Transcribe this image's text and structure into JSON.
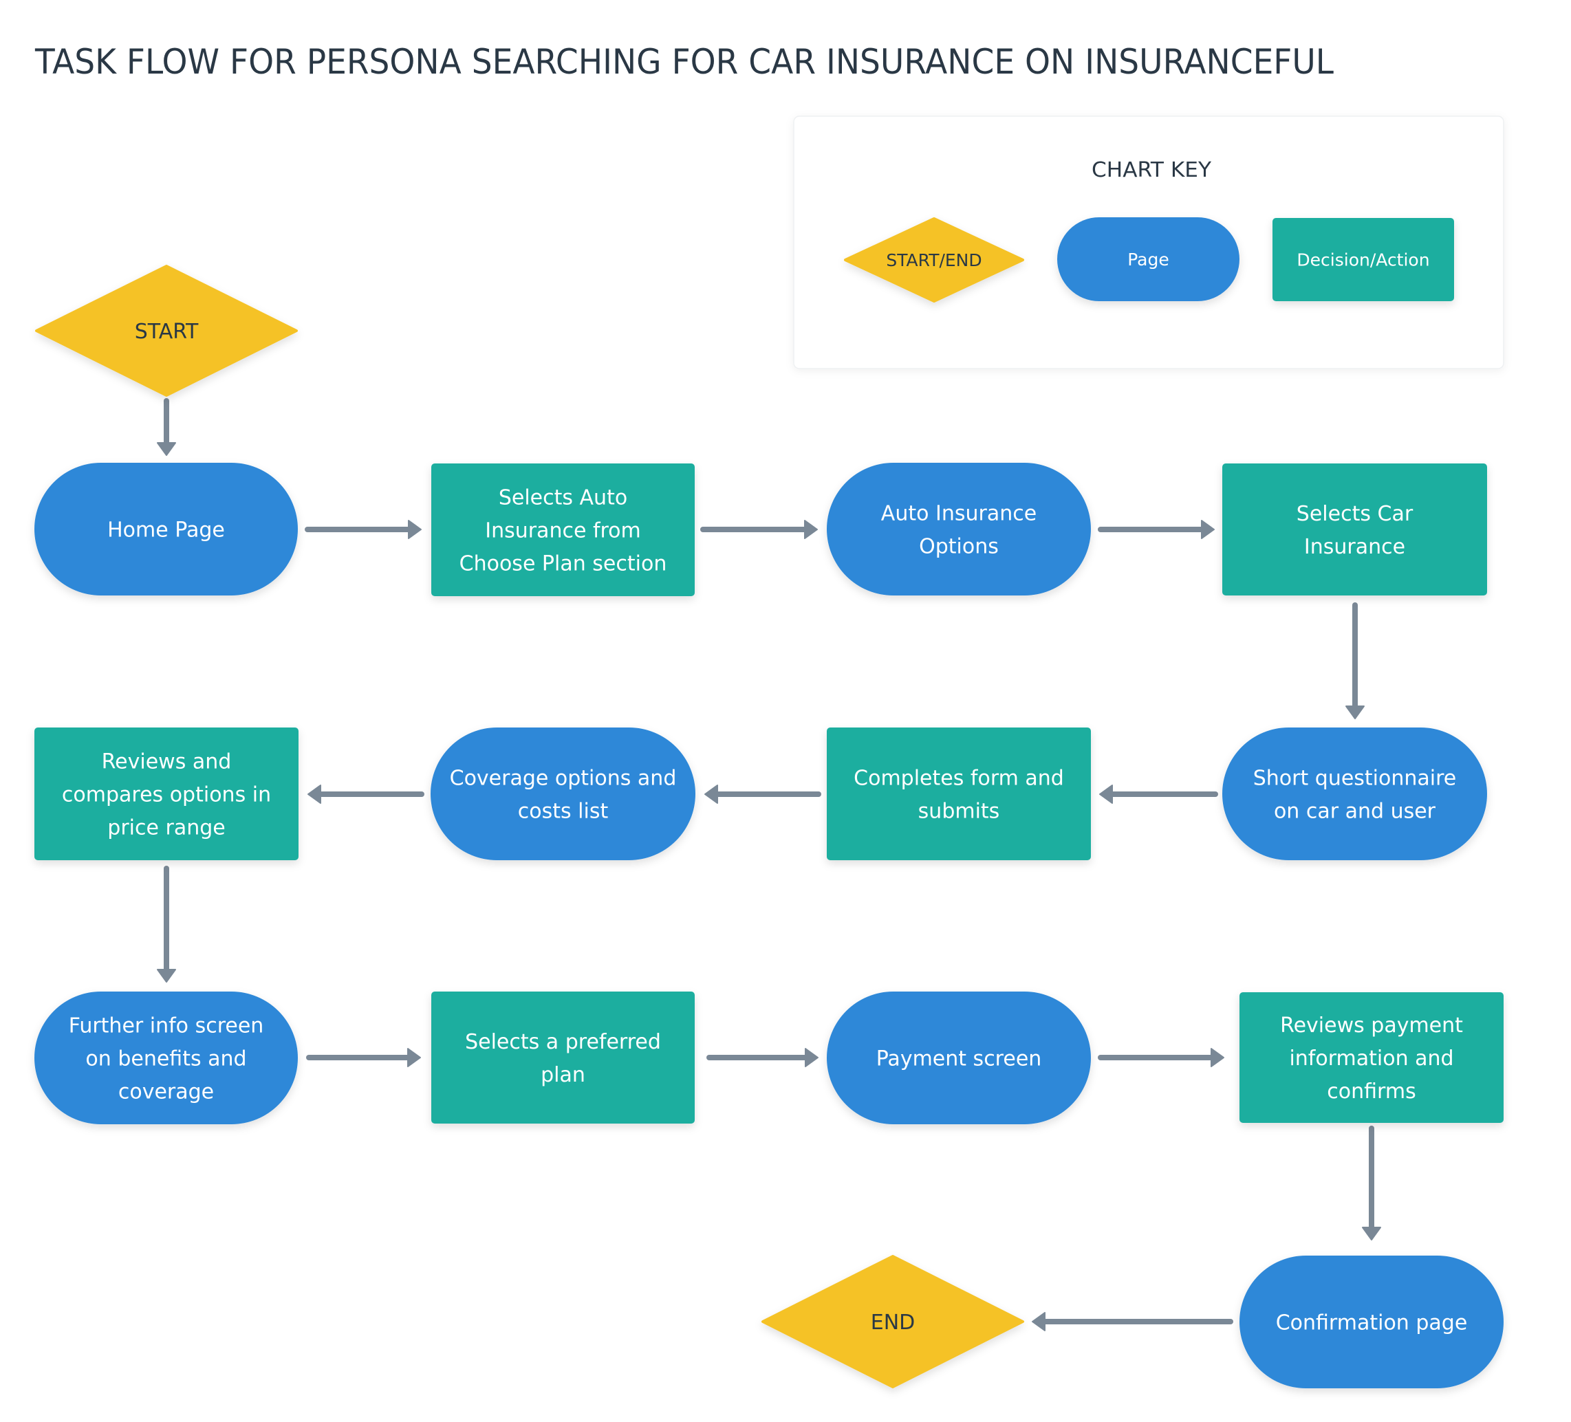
{
  "title": "TASK FLOW FOR PERSONA SEARCHING FOR CAR INSURANCE ON INSURANCEFUL",
  "colors": {
    "start_end": "#f5c226",
    "page": "#2e88d8",
    "decision_action": "#1bae9f",
    "arrow": "#7a8896",
    "dark_text": "#2a3845",
    "light_text": "#ffffff",
    "key_border": "#eef0f2"
  },
  "chart_key": {
    "title": "CHART KEY",
    "items": [
      {
        "type": "start_end",
        "label": "START/END"
      },
      {
        "type": "page",
        "label": "Page"
      },
      {
        "type": "decision_action",
        "label": "Decision/Action"
      }
    ]
  },
  "nodes": [
    {
      "id": "start",
      "type": "start_end",
      "lines": [
        "START"
      ]
    },
    {
      "id": "home-page",
      "type": "page",
      "lines": [
        "Home Page"
      ]
    },
    {
      "id": "selects-auto-insurance",
      "type": "decision_action",
      "lines": [
        "Selects Auto",
        "Insurance from",
        "Choose Plan section"
      ]
    },
    {
      "id": "auto-insurance-options",
      "type": "page",
      "lines": [
        "Auto Insurance",
        "Options"
      ]
    },
    {
      "id": "selects-car-insurance",
      "type": "decision_action",
      "lines": [
        "Selects Car",
        "Insurance"
      ]
    },
    {
      "id": "short-questionnaire",
      "type": "page",
      "lines": [
        "Short questionnaire",
        "on car and user"
      ]
    },
    {
      "id": "completes-form",
      "type": "decision_action",
      "lines": [
        "Completes form and",
        "submits"
      ]
    },
    {
      "id": "coverage-options-list",
      "type": "page",
      "lines": [
        "Coverage options and",
        "costs list"
      ]
    },
    {
      "id": "reviews-compares-options",
      "type": "decision_action",
      "lines": [
        "Reviews and",
        "compares options in",
        "price range"
      ]
    },
    {
      "id": "further-info-screen",
      "type": "page",
      "lines": [
        "Further info screen",
        "on benefits and",
        "coverage"
      ]
    },
    {
      "id": "selects-preferred-plan",
      "type": "decision_action",
      "lines": [
        "Selects a preferred",
        "plan"
      ]
    },
    {
      "id": "payment-screen",
      "type": "page",
      "lines": [
        "Payment screen"
      ]
    },
    {
      "id": "reviews-payment-info",
      "type": "decision_action",
      "lines": [
        "Reviews payment",
        "information and",
        "confirms"
      ]
    },
    {
      "id": "confirmation-page",
      "type": "page",
      "lines": [
        "Confirmation page"
      ]
    },
    {
      "id": "end",
      "type": "start_end",
      "lines": [
        "END"
      ]
    }
  ],
  "edges": [
    {
      "from": "start",
      "to": "home-page"
    },
    {
      "from": "home-page",
      "to": "selects-auto-insurance"
    },
    {
      "from": "selects-auto-insurance",
      "to": "auto-insurance-options"
    },
    {
      "from": "auto-insurance-options",
      "to": "selects-car-insurance"
    },
    {
      "from": "selects-car-insurance",
      "to": "short-questionnaire"
    },
    {
      "from": "short-questionnaire",
      "to": "completes-form"
    },
    {
      "from": "completes-form",
      "to": "coverage-options-list"
    },
    {
      "from": "coverage-options-list",
      "to": "reviews-compares-options"
    },
    {
      "from": "reviews-compares-options",
      "to": "further-info-screen"
    },
    {
      "from": "further-info-screen",
      "to": "selects-preferred-plan"
    },
    {
      "from": "selects-preferred-plan",
      "to": "payment-screen"
    },
    {
      "from": "payment-screen",
      "to": "reviews-payment-info"
    },
    {
      "from": "reviews-payment-info",
      "to": "confirmation-page"
    },
    {
      "from": "confirmation-page",
      "to": "end"
    }
  ]
}
